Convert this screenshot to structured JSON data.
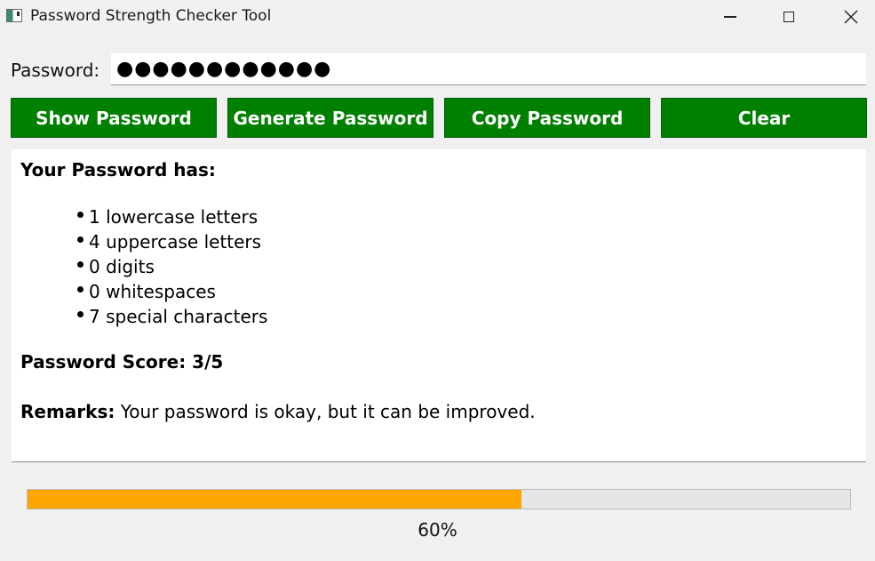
{
  "window": {
    "title": "Password Strength Checker Tool"
  },
  "password": {
    "label": "Password:",
    "masked_value": "●●●●●●●●●●●●"
  },
  "buttons": {
    "show": "Show Password",
    "generate": "Generate Password",
    "copy": "Copy Password",
    "clear": "Clear"
  },
  "result": {
    "heading": "Your Password has:",
    "stats": [
      {
        "count": "1",
        "text": "lowercase letters"
      },
      {
        "count": "4",
        "text": "uppercase letters"
      },
      {
        "count": "0",
        "text": "digits"
      },
      {
        "count": "0",
        "text": "whitespaces"
      },
      {
        "count": "7",
        "text": "special characters"
      }
    ],
    "score": "Password Score: 3/5",
    "remarks_label": "Remarks:",
    "remarks_text": "Your password is okay, but it can be improved."
  },
  "progress": {
    "value": 0.6,
    "text": "60%"
  },
  "colors": {
    "button_bg": "#008000",
    "progress_fill": "#ffa500"
  },
  "icons": {
    "app": "app-window-icon",
    "minimize": "minimize-icon",
    "maximize": "maximize-icon",
    "close": "close-icon"
  }
}
